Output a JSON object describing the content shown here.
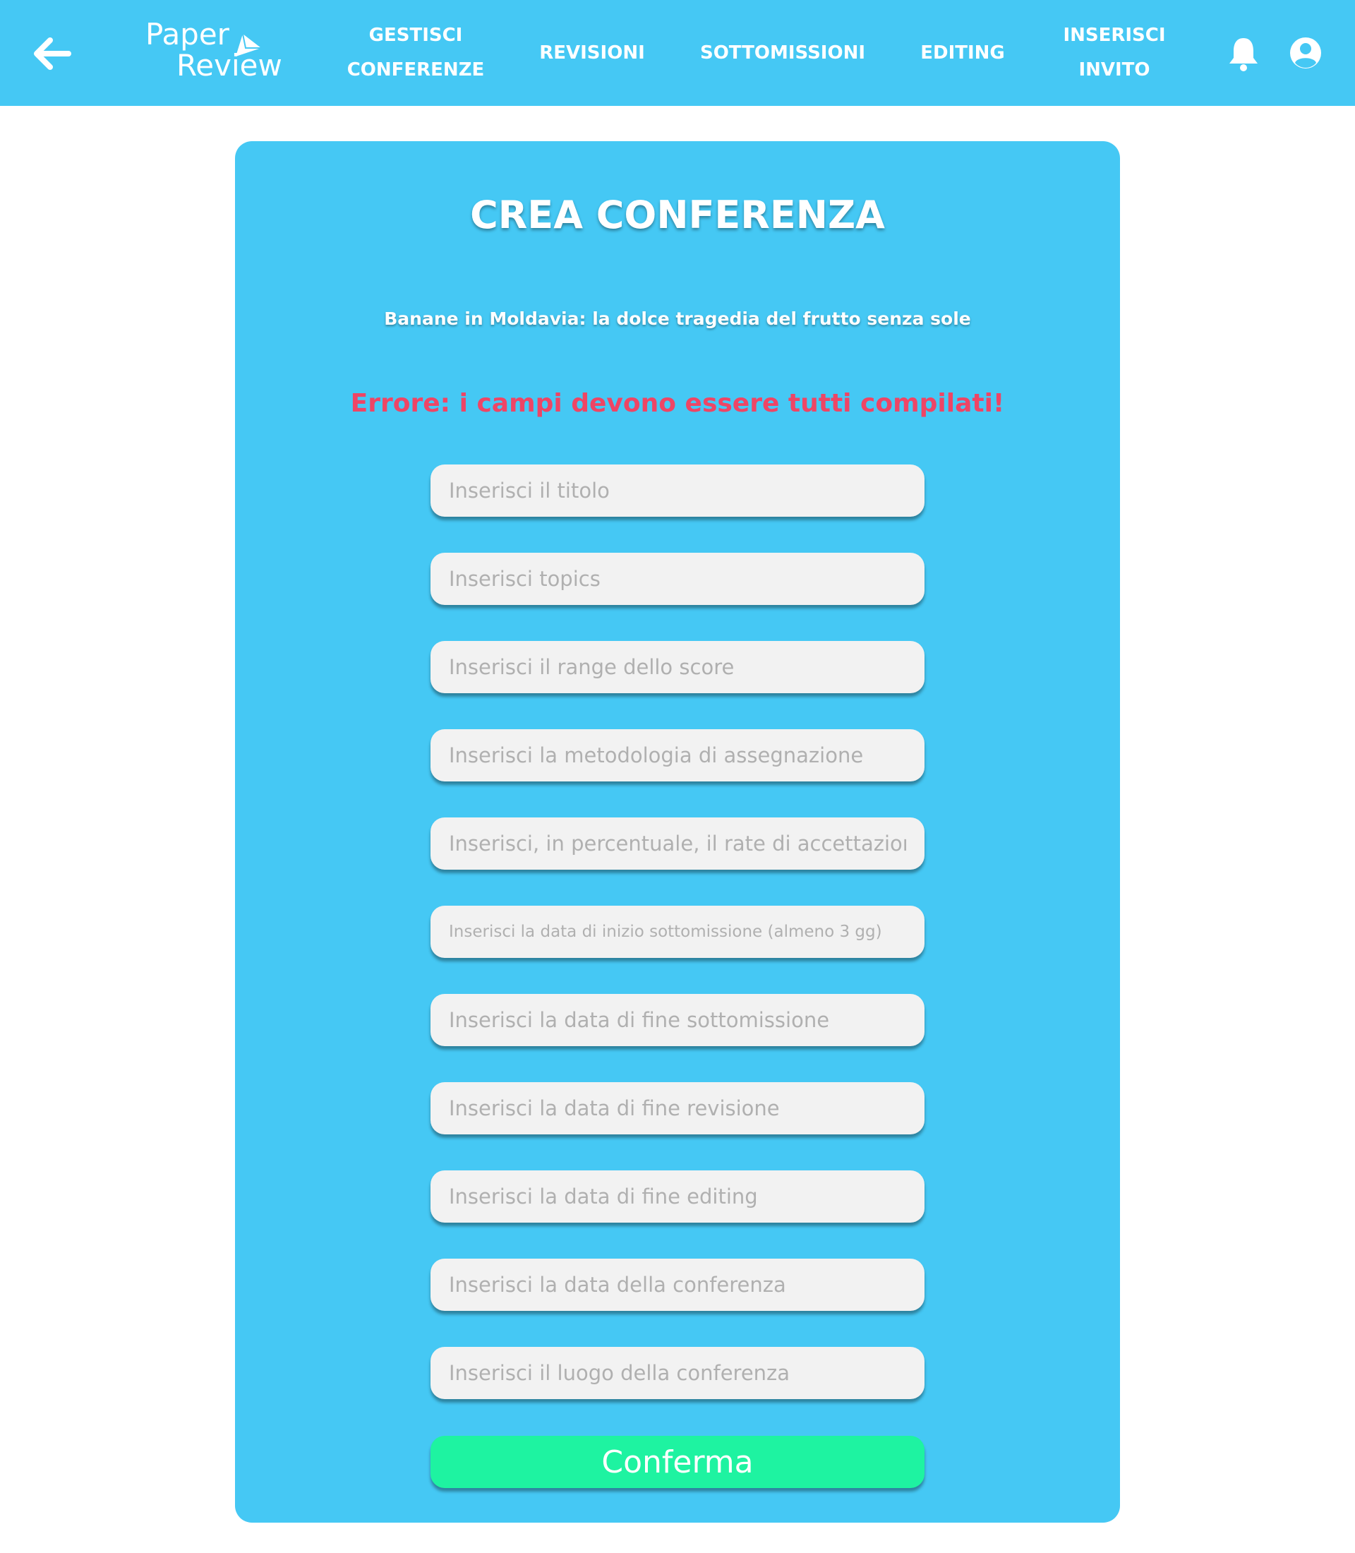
{
  "header": {
    "logo_line1": "Paper",
    "logo_line2": "Review",
    "nav": [
      {
        "label": "GESTISCI\nCONFERENZE"
      },
      {
        "label": "REVISIONI"
      },
      {
        "label": "SOTTOMISSIONI"
      },
      {
        "label": "EDITING"
      },
      {
        "label": "INSERISCI\nINVITO"
      }
    ],
    "icons": {
      "back": "arrow-left-icon",
      "notifications": "bell-icon",
      "account": "user-circle-icon"
    },
    "bar_color": "#45c8f4"
  },
  "form": {
    "title": "CREA CONFERENZA",
    "subtitle": "Banane in Moldavia: la dolce tragedia del frutto senza sole",
    "error": "Errore: i campi devono essere tutti compilati!",
    "fields": [
      {
        "placeholder": "Inserisci il titolo"
      },
      {
        "placeholder": "Inserisci topics"
      },
      {
        "placeholder": "Inserisci il range dello score"
      },
      {
        "placeholder": "Inserisci la metodologia di assegnazione"
      },
      {
        "placeholder": "Inserisci, in percentuale, il rate di accettazione"
      },
      {
        "placeholder": "Inserisci la data di inizio sottomissione (almeno 3 gg)"
      },
      {
        "placeholder": "Inserisci la data di fine sottomissione"
      },
      {
        "placeholder": "Inserisci la data di fine revisione"
      },
      {
        "placeholder": "Inserisci la data di fine editing"
      },
      {
        "placeholder": "Inserisci la data della conferenza"
      },
      {
        "placeholder": "Inserisci il luogo della conferenza"
      }
    ],
    "confirm_label": "Conferma"
  },
  "colors": {
    "accent": "#45c8f4",
    "error": "#ee4565",
    "confirm": "#1ef3a1",
    "field_bg": "#f2f2f2"
  }
}
